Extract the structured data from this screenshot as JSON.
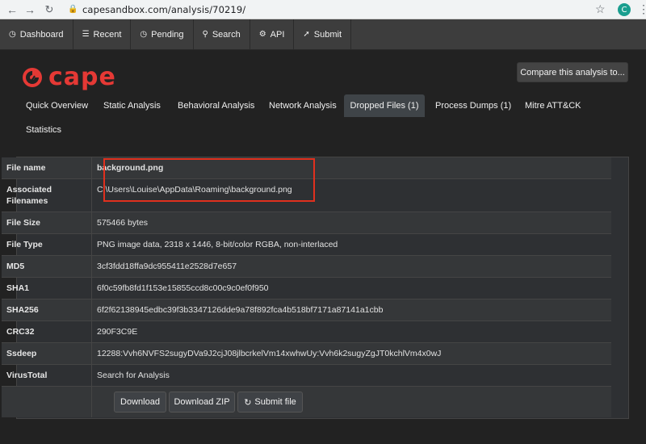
{
  "browser": {
    "url": "capesandbox.com/analysis/70219/",
    "avatar_letter": "C"
  },
  "topnav": {
    "items": [
      {
        "label": "Dashboard",
        "icon": "dashboard-icon"
      },
      {
        "label": "Recent",
        "icon": "list-icon"
      },
      {
        "label": "Pending",
        "icon": "clock-icon"
      },
      {
        "label": "Search",
        "icon": "search-icon"
      },
      {
        "label": "API",
        "icon": "gear-icon"
      },
      {
        "label": "Submit",
        "icon": "upload-icon"
      }
    ]
  },
  "logo": {
    "text": "cape",
    "color": "#e53935"
  },
  "compare_button": "Compare this analysis to...",
  "tabs": [
    {
      "label": "Quick Overview"
    },
    {
      "label": "Static Analysis"
    },
    {
      "label": "Behavioral Analysis"
    },
    {
      "label": "Network Analysis"
    },
    {
      "label": "Dropped Files (1)",
      "active": true
    },
    {
      "label": "Process Dumps (1)"
    },
    {
      "label": "Mitre ATT&CK"
    },
    {
      "label": "Statistics"
    }
  ],
  "file": {
    "rows": [
      {
        "label": "File name",
        "value": "background.png"
      },
      {
        "label": "Associated Filenames",
        "value": "C:\\Users\\Louise\\AppData\\Roaming\\background.png"
      },
      {
        "label": "File Size",
        "value": "575466 bytes"
      },
      {
        "label": "File Type",
        "value": "PNG image data, 2318 x 1446, 8-bit/color RGBA, non-interlaced"
      },
      {
        "label": "MD5",
        "value": "3cf3fdd18ffa9dc955411e2528d7e657"
      },
      {
        "label": "SHA1",
        "value": "6f0c59fb8fd1f153e15855ccd8c00c9c0ef0f950"
      },
      {
        "label": "SHA256",
        "value": "6f2f62138945edbc39f3b3347126dde9a78f892fca4b518bf7171a87141a1cbb"
      },
      {
        "label": "CRC32",
        "value": "290F3C9E"
      },
      {
        "label": "Ssdeep",
        "value": "12288:Vvh6NVFS2sugyDVa9J2cjJ08jlbcrkelVm14xwhwUy:Vvh6k2sugyZgJT0kchlVm4x0wJ"
      },
      {
        "label": "VirusTotal",
        "value": "Search for Analysis"
      }
    ],
    "buttons": {
      "download": "Download",
      "download_zip": "Download ZIP",
      "submit_file": "Submit file"
    }
  },
  "colors": {
    "highlight": "#e0301e",
    "background": "#222222"
  }
}
